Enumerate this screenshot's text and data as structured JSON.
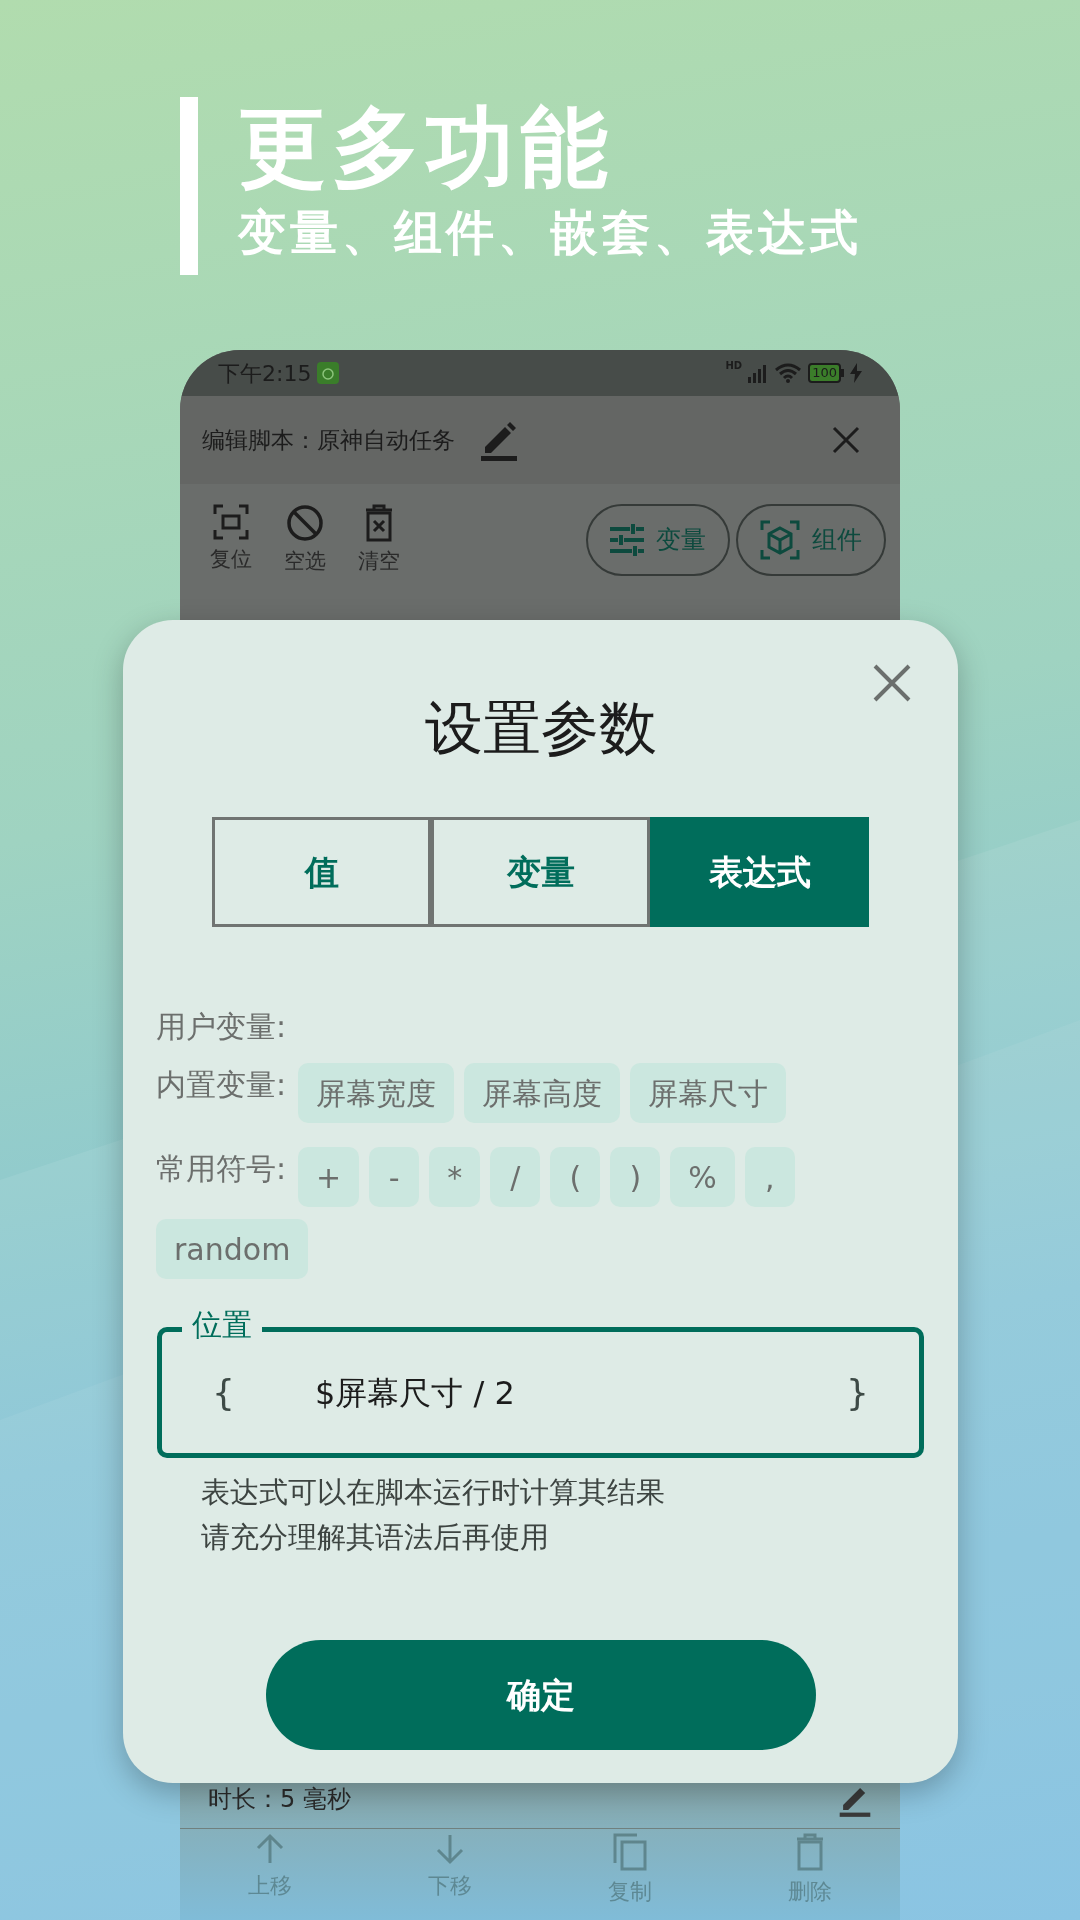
{
  "headline": {
    "title": "更多功能",
    "subtitle": "变量、组件、嵌套、表达式"
  },
  "phone": {
    "status_bar": {
      "time": "下午2:15",
      "network": "HD",
      "battery": "100"
    },
    "app_bar": {
      "title": "编辑脚本：原神自动任务"
    },
    "toolbar": {
      "actions": [
        {
          "label": "复位",
          "kind": "reset"
        },
        {
          "label": "空选",
          "kind": "none"
        },
        {
          "label": "清空",
          "kind": "clear"
        }
      ],
      "chips": [
        {
          "label": "变量",
          "kind": "variable"
        },
        {
          "label": "组件",
          "kind": "component"
        }
      ]
    },
    "row_text": "时长：5 毫秒",
    "bottom_actions": [
      {
        "label": "上移",
        "kind": "up"
      },
      {
        "label": "下移",
        "kind": "down"
      },
      {
        "label": "复制",
        "kind": "copy"
      },
      {
        "label": "删除",
        "kind": "delete"
      }
    ]
  },
  "dialog": {
    "title": "设置参数",
    "tabs": [
      {
        "label": "值",
        "selected": false
      },
      {
        "label": "变量",
        "selected": false
      },
      {
        "label": "表达式",
        "selected": true
      }
    ],
    "user_vars_label": "用户变量:",
    "builtin_label": "内置变量:",
    "builtin_vars": [
      "屏幕宽度",
      "屏幕高度",
      "屏幕尺寸"
    ],
    "symbols_label": "常用符号:",
    "symbols": [
      "+",
      "-",
      "*",
      "/",
      "(",
      ")",
      "%",
      ",",
      "random"
    ],
    "field": {
      "label": "位置",
      "open_brace": "{",
      "value": "$屏幕尺寸 / 2",
      "close_brace": "}"
    },
    "help": [
      "表达式可以在脚本运行时计算其结果",
      "请充分理解其语法后再使用"
    ],
    "confirm": "确定"
  }
}
